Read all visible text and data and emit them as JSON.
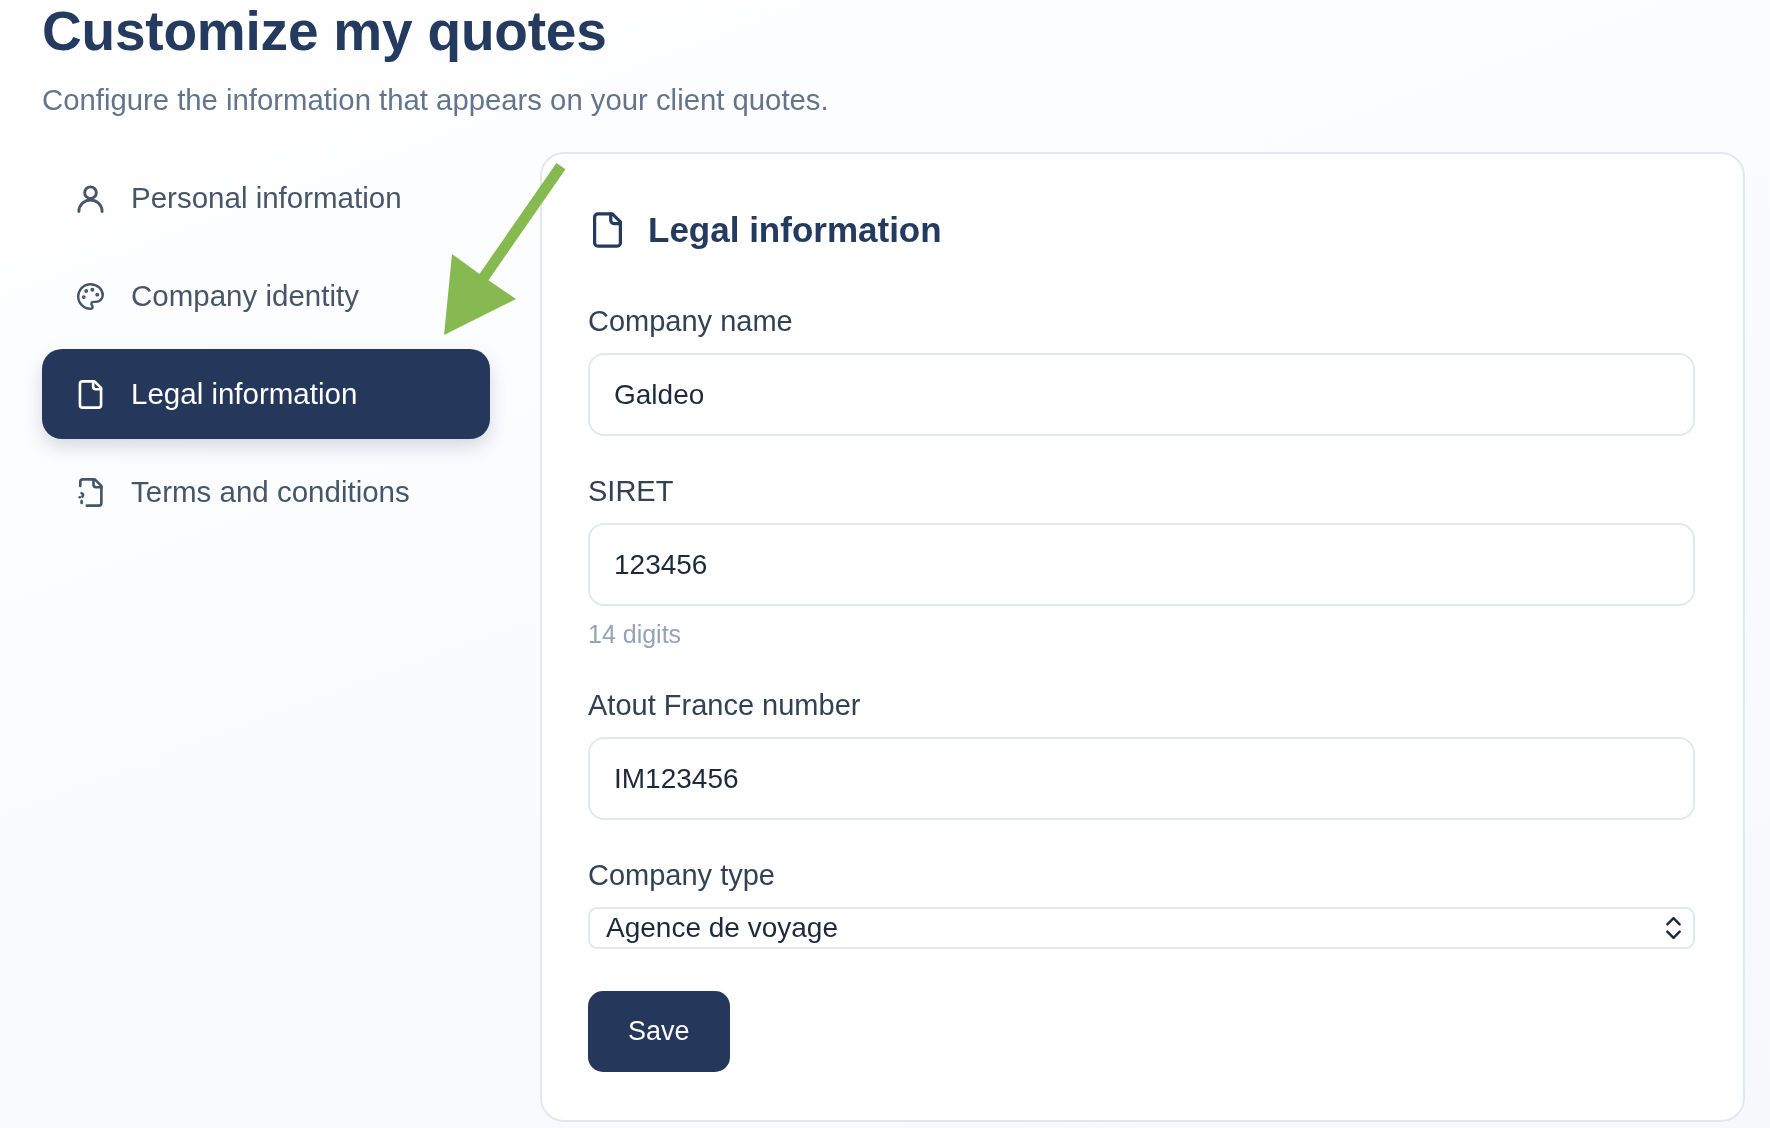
{
  "page": {
    "title": "Customize my quotes",
    "subtitle": "Configure the information that appears on your client quotes."
  },
  "sidebar": {
    "items": [
      {
        "label": "Personal information",
        "selected": false
      },
      {
        "label": "Company identity",
        "selected": false
      },
      {
        "label": "Legal information",
        "selected": true
      },
      {
        "label": "Terms and conditions",
        "selected": false
      }
    ]
  },
  "card": {
    "title": "Legal information",
    "fields": [
      {
        "kind": "text",
        "label": "Company name",
        "value": "Galdeo"
      },
      {
        "kind": "text",
        "label": "SIRET",
        "value": "123456",
        "hint": "14 digits"
      },
      {
        "kind": "text",
        "label": "Atout France number",
        "value": "IM123456"
      },
      {
        "kind": "select",
        "label": "Company type",
        "value": "Agence de voyage"
      }
    ],
    "save_button": "Save"
  }
}
